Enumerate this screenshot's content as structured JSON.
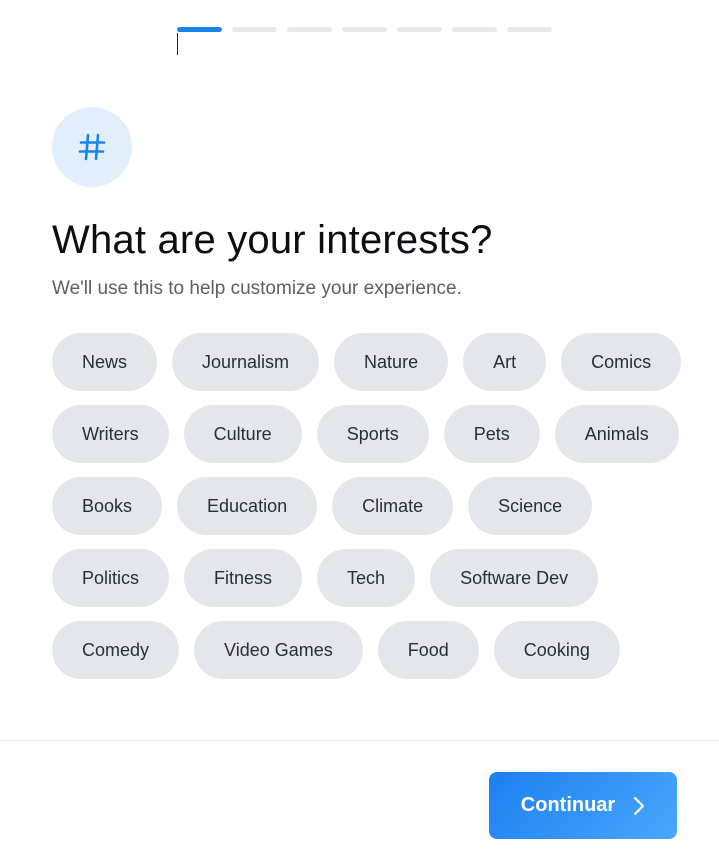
{
  "progress": {
    "total_steps": 7,
    "current_step": 1
  },
  "header_icon": {
    "name": "hashtag-icon",
    "glyph": "#",
    "color": "#1c84e8"
  },
  "title": "What are your interests?",
  "subtitle": "We'll use this to help customize your experience.",
  "interests": [
    "News",
    "Journalism",
    "Nature",
    "Art",
    "Comics",
    "Writers",
    "Culture",
    "Sports",
    "Pets",
    "Animals",
    "Books",
    "Education",
    "Climate",
    "Science",
    "Politics",
    "Fitness",
    "Tech",
    "Software Dev",
    "Comedy",
    "Video Games",
    "Food",
    "Cooking"
  ],
  "footer": {
    "continue_label": "Continuar",
    "continue_icon": "chevron-right-icon"
  },
  "colors": {
    "accent": "#1c84e8",
    "chip_bg": "#e3e6ea",
    "icon_bg": "#e1effd"
  }
}
